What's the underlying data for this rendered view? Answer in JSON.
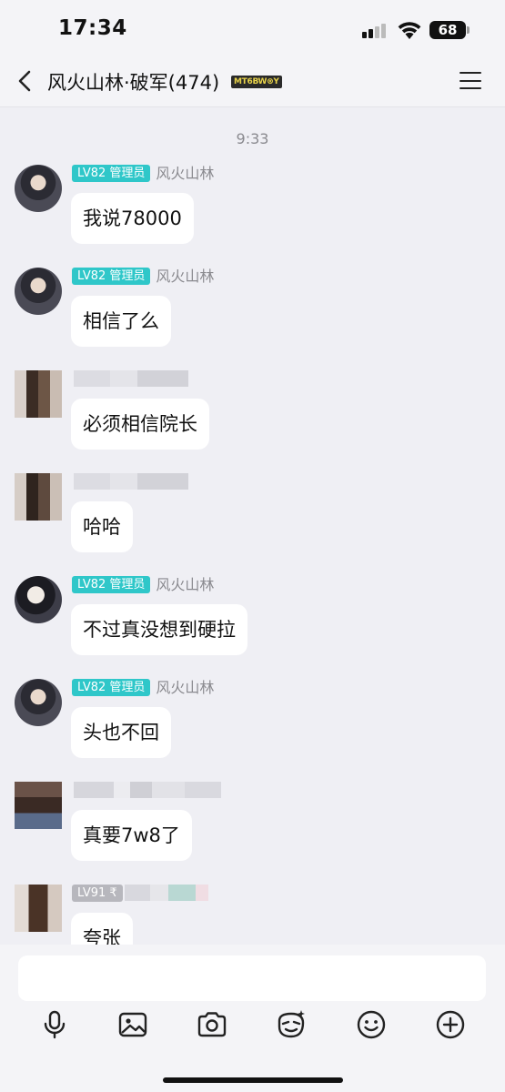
{
  "status_bar": {
    "time": "17:34",
    "battery": "68"
  },
  "header": {
    "title": "风火山林·破军(474)",
    "badge": "MT6BW⊗Y"
  },
  "chat": {
    "timestamp": "9:33",
    "messages": [
      {
        "level": "LV82 管理员",
        "sender": "风火山林",
        "text": "我说78000"
      },
      {
        "level": "LV82 管理员",
        "sender": "风火山林",
        "text": "相信了么"
      },
      {
        "level": "",
        "sender": "",
        "text": "必须相信院长"
      },
      {
        "level": "",
        "sender": "",
        "text": "哈哈"
      },
      {
        "level": "LV82 管理员",
        "sender": "风火山林",
        "text": "不过真没想到硬拉"
      },
      {
        "level": "LV82 管理员",
        "sender": "风火山林",
        "text": "头也不回"
      },
      {
        "level": "",
        "sender": "",
        "text": "真要7w8了"
      },
      {
        "level": "LV91 ₹",
        "sender": "",
        "text": "夸张"
      }
    ]
  },
  "input": {
    "placeholder": ""
  },
  "toolbar": {
    "icons": [
      "microphone-icon",
      "image-icon",
      "camera-icon",
      "emoji-sticker-icon",
      "smiley-icon",
      "plus-icon"
    ]
  }
}
